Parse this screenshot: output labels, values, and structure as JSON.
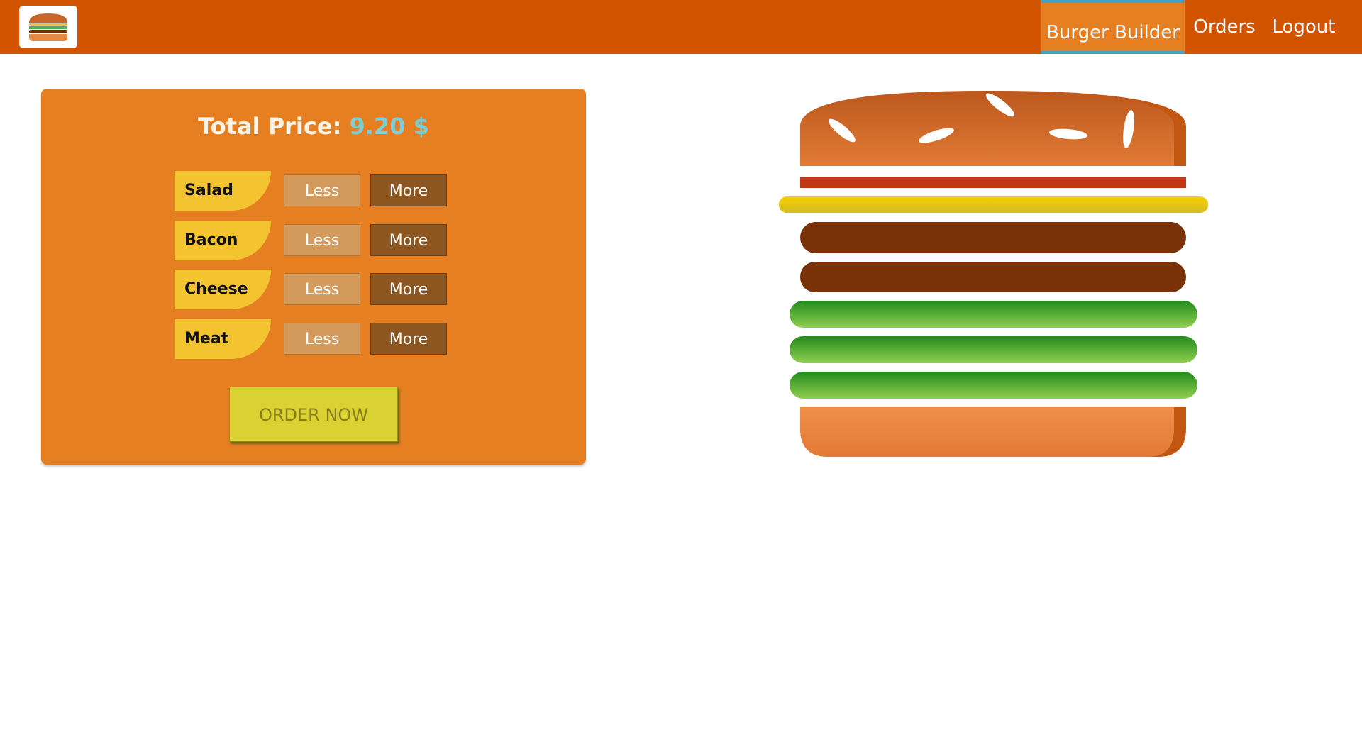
{
  "toolbar": {
    "logo_icon": "burger-logo-icon",
    "nav": [
      {
        "label": "Burger Builder",
        "active": true
      },
      {
        "label": "Orders",
        "active": false
      },
      {
        "label": "Logout",
        "active": false
      }
    ],
    "colors": {
      "bar": "#d35400",
      "active_item": "#e67e22",
      "active_border": "#40a4c8"
    }
  },
  "controls": {
    "price_label": "Total Price:",
    "price_value": "9.20 $",
    "rows": [
      {
        "label": "Salad",
        "less": "Less",
        "more": "More"
      },
      {
        "label": "Bacon",
        "less": "Less",
        "more": "More"
      },
      {
        "label": "Cheese",
        "less": "Less",
        "more": "More"
      },
      {
        "label": "Meat",
        "less": "Less",
        "more": "More"
      }
    ],
    "order_button": "ORDER NOW",
    "colors": {
      "card": "#e67e22",
      "label": "#f4c430",
      "less": "#d49a5c",
      "more": "#8d5520",
      "order": "#dad232"
    }
  },
  "burger": {
    "layers_top_to_bottom": [
      "bread-top",
      "bacon",
      "cheese",
      "meat",
      "meat",
      "salad",
      "salad",
      "salad",
      "bread-bottom"
    ]
  }
}
